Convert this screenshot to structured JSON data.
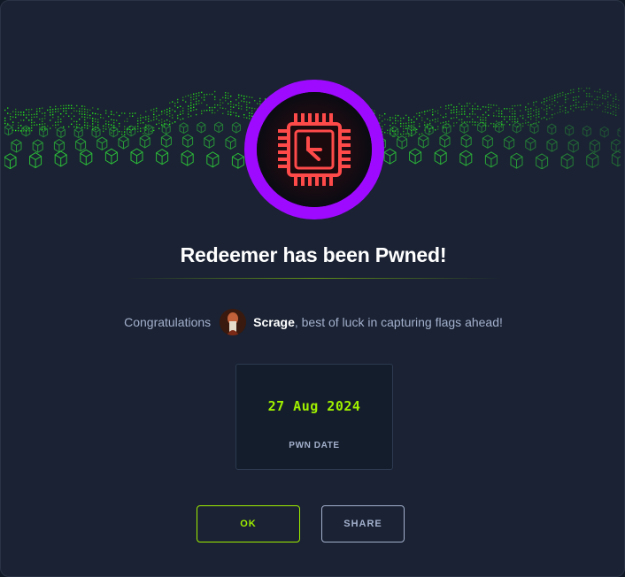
{
  "dialog": {
    "title": "Redeemer has been Pwned!",
    "congrats_prefix": "Congratulations",
    "username": "Scrage",
    "congrats_suffix": ", best of luck in capturing flags ahead!",
    "pwn_date": "27 Aug 2024",
    "pwn_date_label": "PWN DATE",
    "ok_label": "OK",
    "share_label": "SHARE"
  },
  "icons": {
    "badge": "cpu-clock-icon",
    "avatar": "user-avatar"
  },
  "colors": {
    "background": "#1a2233",
    "accent_green": "#9fef00",
    "badge_ring": "#9e0aff",
    "badge_icon": "#ff3e3e",
    "muted_text": "#a4b1cd"
  }
}
